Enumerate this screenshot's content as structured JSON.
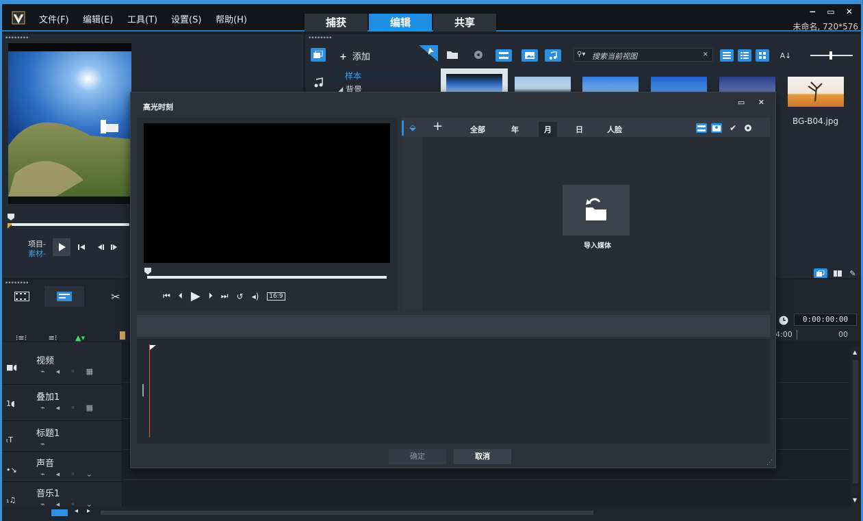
{
  "menu": {
    "file": "文件(F)",
    "edit": "编辑(E)",
    "tools": "工具(T)",
    "settings": "设置(S)",
    "help": "帮助(H)"
  },
  "tabs": [
    "捕获",
    "编辑",
    "共享"
  ],
  "window": {
    "title": "未命名, 720*576",
    "controls": "− ▭ ✕"
  },
  "player": {
    "project_label": "项目-",
    "clip_label": "素材-"
  },
  "library": {
    "add_label": "添加",
    "search_placeholder": "搜索当前视图",
    "tree": [
      "样本",
      "背景"
    ],
    "last_thumb_name": "BG-B04.jpg"
  },
  "timeline": {
    "timecode": "0:00:00:00",
    "ruler": [
      "4:00",
      "00"
    ],
    "tracks": [
      {
        "name": "视频",
        "icon": "video-track-icon"
      },
      {
        "name": "叠加1",
        "icon": "overlay-track-icon"
      },
      {
        "name": "标题1",
        "icon": "title-track-icon"
      },
      {
        "name": "声音",
        "icon": "voice-track-icon"
      },
      {
        "name": "音乐1",
        "icon": "music-track-icon"
      }
    ]
  },
  "dialog": {
    "title": "高光时刻",
    "filters": [
      "全部",
      "年",
      "月",
      "日",
      "人脸"
    ],
    "active_filter": "月",
    "import_label": "导入媒体",
    "aspect": "16:9",
    "ok": "确定",
    "cancel": "取消",
    "controls": "▭ ✕"
  },
  "colors": {
    "accent": "#1e8fe1",
    "background": "#1b2129",
    "panel": "#242a33",
    "dialog": "#2c323a"
  }
}
